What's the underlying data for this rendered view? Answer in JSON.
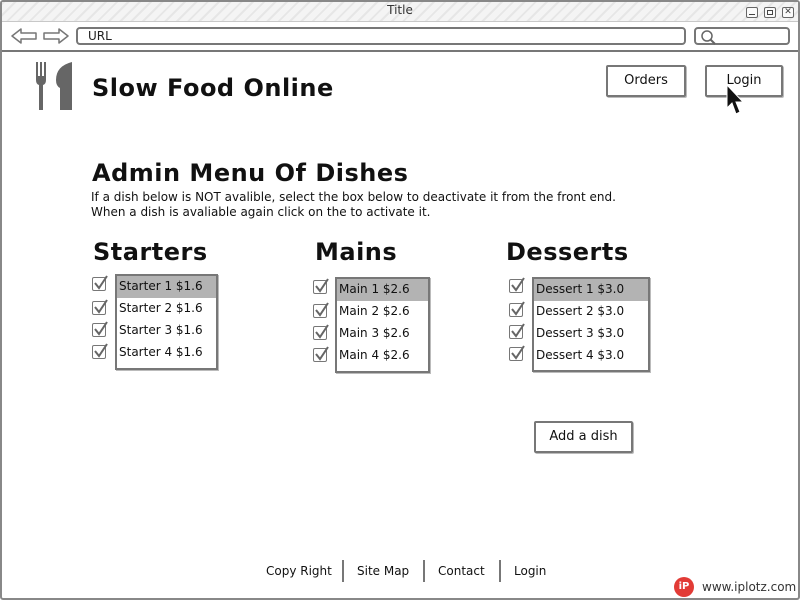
{
  "window": {
    "title": "Title"
  },
  "browser": {
    "url": "URL"
  },
  "header": {
    "site_title": "Slow Food Online",
    "orders_label": "Orders",
    "login_label": "Login"
  },
  "page": {
    "heading": "Admin Menu Of Dishes",
    "instructions": [
      "If a dish below is NOT avalible, select the box below to deactivate it from the front end.",
      "When a dish is avaliable again click on the to activate it."
    ]
  },
  "menu": {
    "starters": {
      "title": "Starters",
      "items": [
        "Starter 1  $1.6",
        "Starter 2  $1.6",
        "Starter 3  $1.6",
        "Starter 4  $1.6"
      ]
    },
    "mains": {
      "title": "Mains",
      "items": [
        "Main 1  $2.6",
        "Main 2  $2.6",
        "Main 3  $2.6",
        "Main 4  $2.6"
      ]
    },
    "desserts": {
      "title": "Desserts",
      "items": [
        "Dessert 1  $3.0",
        "Dessert 2  $3.0",
        "Dessert 3  $3.0",
        "Dessert 4  $3.0"
      ]
    }
  },
  "actions": {
    "add_dish_label": "Add a dish"
  },
  "footer": {
    "links": [
      "Copy Right",
      "Site Map",
      "Contact",
      "Login"
    ]
  },
  "watermark": {
    "logo": "iP",
    "text": "www.iplotz.com"
  },
  "colors": {
    "selected": "#b3b3b3",
    "border": "#777777",
    "watermark": "#e23b36"
  }
}
